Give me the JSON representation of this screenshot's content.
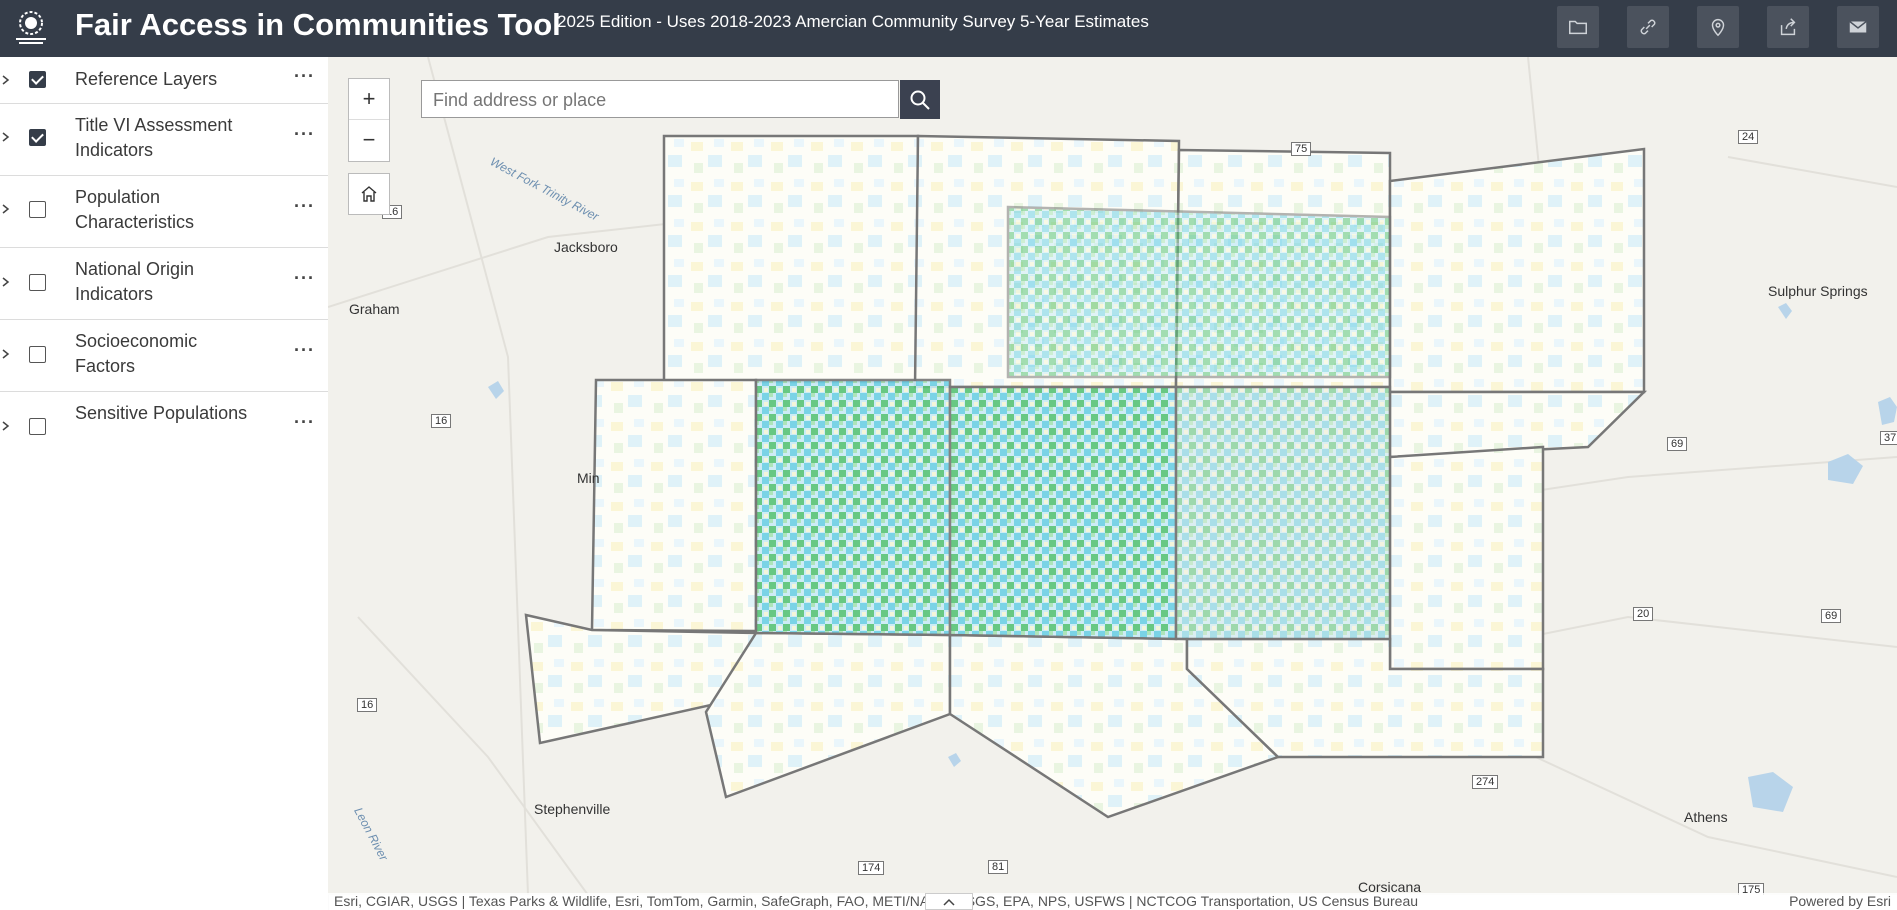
{
  "header": {
    "title": "Fair Access in Communities Tool",
    "subtitle": "2025 Edition - Uses 2018-2023 Amercian Community Survey 5-Year Estimates",
    "logo_icon": "nctcog-logo-icon",
    "actions": [
      {
        "icon": "folder-icon"
      },
      {
        "icon": "link-icon"
      },
      {
        "icon": "map-pin-icon"
      },
      {
        "icon": "share-icon"
      },
      {
        "icon": "mail-icon"
      }
    ]
  },
  "layers": [
    {
      "label": "Reference Layers",
      "checked": true
    },
    {
      "label": "Title VI Assessment Indicators",
      "checked": true
    },
    {
      "label": "Population Characteristics",
      "checked": false
    },
    {
      "label": "National Origin Indicators",
      "checked": false
    },
    {
      "label": "Socioeconomic Factors",
      "checked": false
    },
    {
      "label": "Sensitive Populations",
      "checked": false
    }
  ],
  "layer_more_label": "···",
  "map": {
    "zoom_in": "+",
    "zoom_out": "−",
    "search_placeholder": "Find address or place",
    "labels": {
      "jacksboro": "Jacksboro",
      "graham": "Graham",
      "sulphur_springs": "Sulphur Springs",
      "stephenville": "Stephenville",
      "athens": "Athens",
      "corsicana": "Corsicana",
      "min": "Min",
      "west_fork": "West Fork Trinity River",
      "leon_river": "Leon River"
    },
    "shields": {
      "s16a": "16",
      "s16b": "16",
      "s16c": "16",
      "s75": "75",
      "s24": "24",
      "s69a": "69",
      "s69b": "69",
      "s20": "20",
      "s274": "274",
      "s174": "174",
      "s81": "81",
      "s175": "175",
      "s37": "37"
    },
    "attribution": "Esri, CGIAR, USGS | Texas Parks & Wildlife, Esri, TomTom, Garmin, SafeGraph, FAO, METI/NASA, USGS, EPA, NPS, USFWS | NCTCOG Transportation, US Census Bureau",
    "powered_by": "Powered by Esri"
  }
}
